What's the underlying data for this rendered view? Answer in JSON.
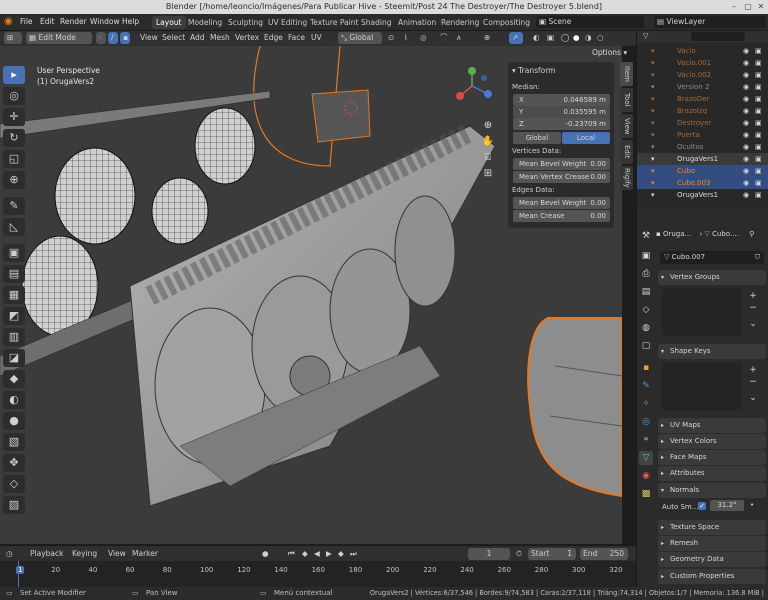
{
  "window": {
    "title": "Blender [/home/leoncio/Imágenes/Para Publicar Hive - Steemit/Post 24 The Destroyer/The Destroyer 5.blend]"
  },
  "menubar": {
    "items": [
      "File",
      "Edit",
      "Render",
      "Window",
      "Help"
    ],
    "workspaces": [
      "Layout",
      "Modeling",
      "Sculpting",
      "UV Editing",
      "Texture Paint",
      "Shading",
      "Animation",
      "Rendering",
      "Compositing"
    ],
    "active_workspace": "Layout",
    "scene_label": "Scene",
    "viewlayer_label": "ViewLayer"
  },
  "viewport_header": {
    "mode": "Edit Mode",
    "menus": [
      "View",
      "Select",
      "Add",
      "Mesh",
      "Vertex",
      "Edge",
      "Face",
      "UV"
    ],
    "orientation": "Global",
    "options_label": "Options"
  },
  "viewport": {
    "perspective": "User Perspective",
    "object_label": "(1) OrugaVers2"
  },
  "tools": [
    {
      "icon": "select-box-icon",
      "glyph": "▸"
    },
    {
      "icon": "cursor-icon",
      "glyph": "◎"
    },
    {
      "icon": "move-icon",
      "glyph": "✛"
    },
    {
      "icon": "rotate-icon",
      "glyph": "↻"
    },
    {
      "icon": "scale-icon",
      "glyph": "◱"
    },
    {
      "icon": "transform-icon",
      "glyph": "⊕"
    },
    {
      "icon": "annotate-icon",
      "glyph": "✎"
    },
    {
      "icon": "measure-icon",
      "glyph": "◺"
    },
    {
      "icon": "add-cube-icon",
      "glyph": "▣"
    },
    {
      "icon": "extrude-icon",
      "glyph": "▤"
    },
    {
      "icon": "inset-icon",
      "glyph": "▦"
    },
    {
      "icon": "bevel-icon",
      "glyph": "◩"
    },
    {
      "icon": "loop-cut-icon",
      "glyph": "▥"
    },
    {
      "icon": "knife-icon",
      "glyph": "◪"
    },
    {
      "icon": "poly-build-icon",
      "glyph": "◆"
    },
    {
      "icon": "spin-icon",
      "glyph": "◐"
    },
    {
      "icon": "smooth-icon",
      "glyph": "●"
    },
    {
      "icon": "edge-slide-icon",
      "glyph": "▧"
    },
    {
      "icon": "shrink-icon",
      "glyph": "✥"
    },
    {
      "icon": "shear-icon",
      "glyph": "◇"
    },
    {
      "icon": "rip-icon",
      "glyph": "▨"
    }
  ],
  "npanel": {
    "section": "Transform",
    "median_label": "Median:",
    "coords": [
      {
        "axis": "X",
        "value": "0.046589 m"
      },
      {
        "axis": "Y",
        "value": "0.035595 m"
      },
      {
        "axis": "Z",
        "value": "-0.23709 m"
      }
    ],
    "global_label": "Global",
    "local_label": "Local",
    "vertices_header": "Vertices Data:",
    "vertices": [
      {
        "label": "Mean Bevel Weight",
        "value": "0.00"
      },
      {
        "label": "Mean Vertex Crease",
        "value": "0.00"
      }
    ],
    "edges_header": "Edges Data:",
    "edges": [
      {
        "label": "Mean Bevel Weight",
        "value": "0.00"
      },
      {
        "label": "Mean Crease",
        "value": "0.00"
      }
    ],
    "side_tabs": [
      "Item",
      "Tool",
      "View",
      "Edit",
      "Rigify"
    ]
  },
  "outliner": {
    "rows": [
      {
        "name": "Vacio",
        "color": "#a56a3a",
        "state": "normal"
      },
      {
        "name": "Vacio.001",
        "color": "#a56a3a",
        "state": "normal"
      },
      {
        "name": "Vacio.002",
        "color": "#a56a3a",
        "state": "normal"
      },
      {
        "name": "Version 2",
        "color": "#8a8a8a",
        "state": "normal"
      },
      {
        "name": "BrazoDer",
        "color": "#a56a3a",
        "state": "normal"
      },
      {
        "name": "BrazoIzq",
        "color": "#a56a3a",
        "state": "normal"
      },
      {
        "name": "Destroyer",
        "color": "#a56a3a",
        "state": "normal"
      },
      {
        "name": "Puerta",
        "color": "#a56a3a",
        "state": "normal"
      },
      {
        "name": "Ocultos",
        "color": "#8a8a8a",
        "state": "normal"
      },
      {
        "name": "OrugaVers1",
        "color": "#dddddd",
        "state": "hl"
      },
      {
        "name": "Cubo",
        "color": "#e0883a",
        "state": "sel"
      },
      {
        "name": "Cubo.003",
        "color": "#e0883a",
        "state": "sel"
      },
      {
        "name": "OrugaVers1",
        "color": "#dddddd",
        "state": "normal"
      }
    ]
  },
  "properties": {
    "breadcrumb_a": "Oruga...",
    "breadcrumb_b": "Cubo....",
    "data_name": "Cubo.007",
    "panels_open": [
      {
        "label": "Vertex Groups"
      },
      {
        "label": "Shape Keys"
      }
    ],
    "panels_closed": [
      {
        "label": "UV Maps"
      },
      {
        "label": "Vertex Colors"
      },
      {
        "label": "Face Maps"
      },
      {
        "label": "Attributes"
      }
    ],
    "normals_label": "Normals",
    "auto_smooth_label": "Auto Sm...",
    "auto_smooth_value": "31.2°",
    "panels_bottom": [
      {
        "label": "Texture Space"
      },
      {
        "label": "Remesh"
      },
      {
        "label": "Geometry Data"
      },
      {
        "label": "Custom Properties"
      }
    ]
  },
  "timeline": {
    "menus": [
      "Playback",
      "Keying",
      "View",
      "Marker"
    ],
    "current_frame": "1",
    "start_label": "Start",
    "start": "1",
    "end_label": "End",
    "end": "250",
    "ticks": [
      "1",
      "20",
      "40",
      "60",
      "80",
      "100",
      "120",
      "140",
      "160",
      "180",
      "200",
      "220",
      "240",
      "260",
      "280",
      "300",
      "320"
    ]
  },
  "status": {
    "left": "Set Active Modifier",
    "middle": "Pan View",
    "context": "Menú contextual",
    "stats": "OrugaVers2 | Vértices:6/37,546 | Bordes:9/74,583 | Caras:2/37,118 | Triáng:74,314 | Objetos:1/7 | Memoria: 136.8 MiB |"
  }
}
